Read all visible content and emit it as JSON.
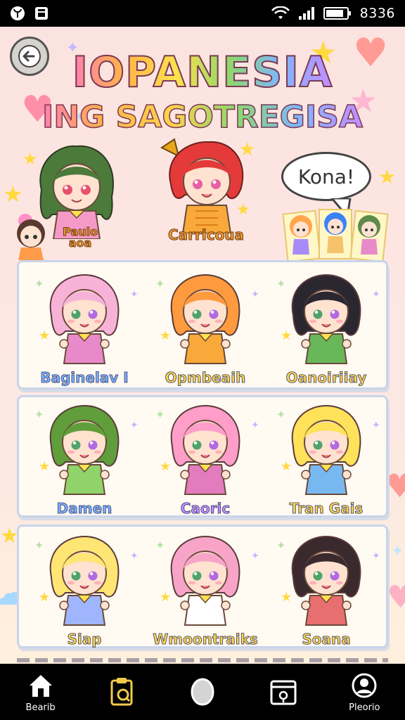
{
  "status_bar": {
    "time": "8336"
  },
  "header": {
    "title": "IOPANESIA",
    "subtitle": "ING SAGOTREGISA",
    "back_icon": "arrow-left-icon"
  },
  "featured": {
    "characters": [
      {
        "name": "Paulo\naoa"
      },
      {
        "name": "Carricoua"
      }
    ],
    "speech_bubble": "Kona!"
  },
  "grid": {
    "rows": [
      [
        {
          "name": "Baginelav I",
          "hair": "#f7b3d7",
          "outfit": "#e889c9",
          "label_color": "#7fb0ff"
        },
        {
          "name": "Opmbeaih",
          "hair": "#ff9a3e",
          "outfit": "#f8a93a",
          "label_color": "#ffd14d"
        },
        {
          "name": "Oanoiriiay",
          "hair": "#2b2730",
          "outfit": "#68b85a",
          "label_color": "#ffd14d"
        }
      ],
      [
        {
          "name": "Damen",
          "hair": "#5f9e3a",
          "outfit": "#8fd36a",
          "label_color": "#7fb0ff"
        },
        {
          "name": "Caoric",
          "hair": "#ff9ec9",
          "outfit": "#e37bbf",
          "label_color": "#c68cff"
        },
        {
          "name": "Tran Gais",
          "hair": "#ffe15a",
          "outfit": "#78b8f0",
          "label_color": "#ffd14d"
        }
      ],
      [
        {
          "name": "Siap",
          "hair": "#ffe573",
          "outfit": "#9fb6ff",
          "label_color": "#ffd14d"
        },
        {
          "name": "Wmoontraiks",
          "hair": "#f8a4c8",
          "outfit": "#ffffff",
          "label_color": "#ffd14d"
        },
        {
          "name": "Soana",
          "hair": "#3a2a2e",
          "outfit": "#e86f6f",
          "label_color": "#ffd14d"
        }
      ]
    ]
  },
  "bottom_nav": {
    "items": [
      {
        "label": "Bearib",
        "icon": "home-icon"
      },
      {
        "label": "",
        "icon": "clipboard-icon"
      },
      {
        "label": "",
        "icon": "circle-button-icon"
      },
      {
        "label": "",
        "icon": "calendar-icon"
      },
      {
        "label": "Pleorio",
        "icon": "profile-icon"
      }
    ]
  },
  "colors": {
    "background": "#fde6e2",
    "panel": "#fffaf2",
    "panel_border": "#c9d4ea",
    "accent_pink": "#ff7fb0",
    "accent_yellow": "#ffd14d"
  }
}
